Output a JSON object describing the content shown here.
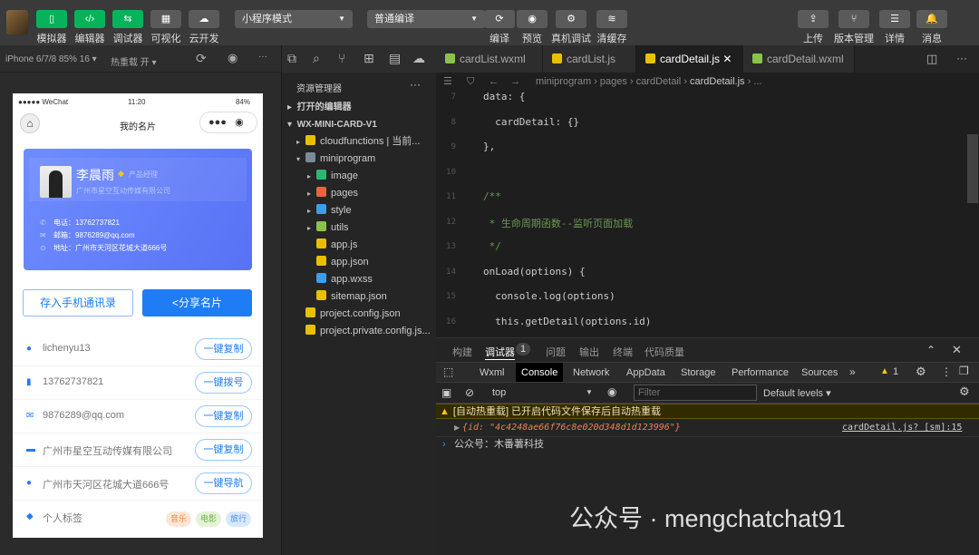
{
  "toolbar": {
    "buttons": [
      {
        "label": "模拟器",
        "icon": "phone-icon"
      },
      {
        "label": "编辑器",
        "icon": "code-icon"
      },
      {
        "label": "调试器",
        "icon": "sliders-icon"
      },
      {
        "label": "可视化",
        "icon": "layout-icon"
      },
      {
        "label": "云开发",
        "icon": "cloud-icon"
      }
    ],
    "mode": "小程序模式",
    "compile": "普通编译",
    "actions": [
      "编译",
      "预览",
      "真机调试",
      "清缓存"
    ],
    "right": [
      "上传",
      "版本管理",
      "详情",
      "消息"
    ]
  },
  "simbar": {
    "device": "iPhone 6/7/8 85% 16 ▾",
    "hotreload": "热重载 开 ▾"
  },
  "phone": {
    "status": {
      "carrier": "●●●●● WeChat",
      "time": "11:20",
      "battery": "84%"
    },
    "title": "我的名片",
    "card": {
      "name": "李晨雨",
      "role": "产品经理",
      "company": "广州市星空互动传媒有限公司",
      "phone": "电话：13762737821",
      "email": "邮箱：9876289@qq.com",
      "address": "地址：广州市天河区花城大道666号"
    },
    "save_btn": "存入手机通讯录",
    "share_btn": "<分享名片",
    "items": [
      {
        "icon": "wechat-icon",
        "text": "lichenyu13",
        "btn": "一键复制"
      },
      {
        "icon": "mobile-icon",
        "text": "13762737821",
        "btn": "一键拨号"
      },
      {
        "icon": "mail-icon",
        "text": "9876289@qq.com",
        "btn": "一键复制"
      },
      {
        "icon": "company-icon",
        "text": "广州市星空互动传媒有限公司",
        "btn": "一键复制"
      },
      {
        "icon": "location-icon",
        "text": "广州市天河区花城大道666号",
        "btn": "一键导航"
      }
    ],
    "tags_label": "个人标签",
    "tags": [
      {
        "text": "音乐",
        "bg": "#fde6d6",
        "fg": "#f08a3c"
      },
      {
        "text": "电影",
        "bg": "#e4f3d6",
        "fg": "#6cb043"
      },
      {
        "text": "旅行",
        "bg": "#d8e8fd",
        "fg": "#4a8ef0"
      }
    ]
  },
  "explorer": {
    "title": "资源管理器",
    "open_editors": "打开的编辑器",
    "project": "WX-MINI-CARD-V1",
    "files": [
      {
        "name": "cloudfunctions | 当前...",
        "indent": 1,
        "arrow": "▸",
        "color": "#e8c000"
      },
      {
        "name": "miniprogram",
        "indent": 1,
        "arrow": "▾",
        "color": "#7a8a99"
      },
      {
        "name": "image",
        "indent": 2,
        "arrow": "▸",
        "color": "#2bb673"
      },
      {
        "name": "pages",
        "indent": 2,
        "arrow": "▸",
        "color": "#e8643c"
      },
      {
        "name": "style",
        "indent": 2,
        "arrow": "▸",
        "color": "#3c9ee8"
      },
      {
        "name": "utils",
        "indent": 2,
        "arrow": "▸",
        "color": "#8bc34a"
      },
      {
        "name": "app.js",
        "indent": 2,
        "arrow": "",
        "color": "#e8c000"
      },
      {
        "name": "app.json",
        "indent": 2,
        "arrow": "",
        "color": "#e8c000"
      },
      {
        "name": "app.wxss",
        "indent": 2,
        "arrow": "",
        "color": "#3c9ee8"
      },
      {
        "name": "sitemap.json",
        "indent": 2,
        "arrow": "",
        "color": "#e8c000"
      },
      {
        "name": "project.config.json",
        "indent": 1,
        "arrow": "",
        "color": "#e8c000"
      },
      {
        "name": "project.private.config.js...",
        "indent": 1,
        "arrow": "",
        "color": "#e8c000"
      }
    ]
  },
  "tabs": [
    {
      "name": "cardList.wxml",
      "color": "#8bc34a"
    },
    {
      "name": "cardList.js",
      "color": "#e8c000"
    },
    {
      "name": "cardDetail.js",
      "color": "#e8c000",
      "active": true
    },
    {
      "name": "cardDetail.wxml",
      "color": "#8bc34a"
    }
  ],
  "breadcrumb": [
    "miniprogram",
    "pages",
    "cardDetail",
    "cardDetail.js",
    "..."
  ],
  "code": [
    {
      "n": "7",
      "t": "data: {"
    },
    {
      "n": "8",
      "t": "  cardDetail: {}"
    },
    {
      "n": "9",
      "t": "},"
    },
    {
      "n": "10",
      "t": ""
    },
    {
      "n": "11",
      "t": "/**"
    },
    {
      "n": "12",
      "t": " * 生命周期函数--监听页面加载"
    },
    {
      "n": "13",
      "t": " */"
    },
    {
      "n": "14",
      "t": "onLoad(options) {"
    },
    {
      "n": "15",
      "t": "  console.log(options)"
    },
    {
      "n": "16",
      "t": "  this.getDetail(options.id)"
    }
  ],
  "panel": {
    "tabs": [
      "构建",
      "调试器",
      "问题",
      "输出",
      "终端",
      "代码质量"
    ],
    "badge": "1",
    "devtabs": [
      "Wxml",
      "Console",
      "Network",
      "AppData",
      "Storage",
      "Performance",
      "Sources"
    ],
    "warn_count": "1",
    "context": "top",
    "filter_placeholder": "Filter",
    "levels": "Default levels ▾",
    "warning": "[自动热重载] 已开启代码文件保存后自动热重载",
    "log": "{id: \"4c4248ae66f76c8e020d348d1d123996\"}",
    "log_source": "cardDetail.js? [sm]:15",
    "input": "公众号：木番薯科技"
  },
  "watermark": "公众号 · mengchatchat91"
}
